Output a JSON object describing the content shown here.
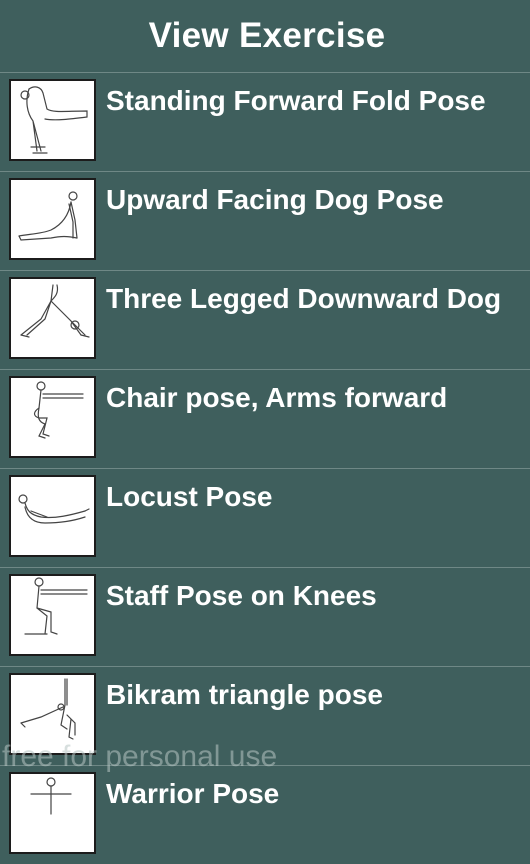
{
  "header": {
    "title": "View Exercise"
  },
  "exercises": [
    {
      "label": "Standing Forward Fold Pose",
      "icon": "standing-forward-fold-icon"
    },
    {
      "label": "Upward Facing Dog Pose",
      "icon": "upward-facing-dog-icon"
    },
    {
      "label": "Three Legged Downward Dog",
      "icon": "three-legged-downward-dog-icon"
    },
    {
      "label": "Chair pose, Arms forward",
      "icon": "chair-pose-icon"
    },
    {
      "label": "Locust Pose",
      "icon": "locust-pose-icon"
    },
    {
      "label": "Staff Pose on Knees",
      "icon": "staff-pose-knees-icon"
    },
    {
      "label": "Bikram triangle pose",
      "icon": "bikram-triangle-icon"
    },
    {
      "label": "Warrior Pose",
      "icon": "warrior-pose-icon"
    }
  ],
  "watermark": "free for personal use",
  "colors": {
    "background": "#3f5f5d",
    "text": "#ffffff",
    "divider": "#6f8886"
  }
}
